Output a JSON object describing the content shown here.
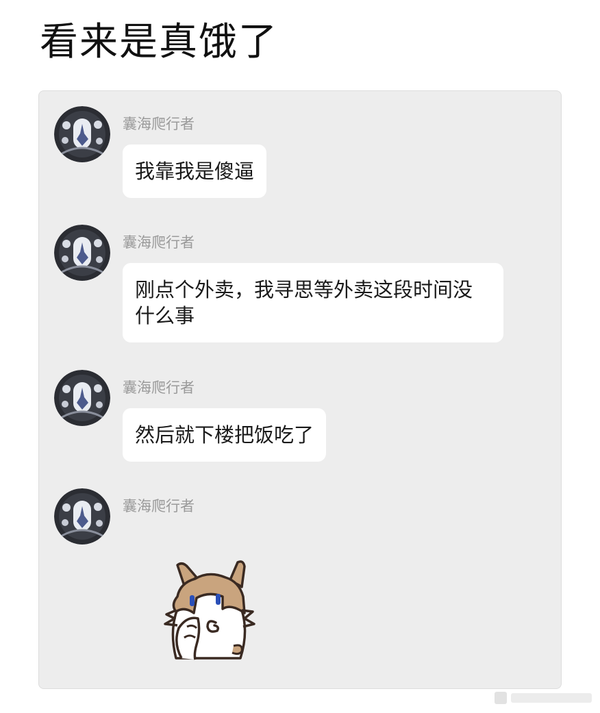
{
  "post": {
    "title": "看来是真饿了"
  },
  "chat": {
    "messages": [
      {
        "sender": "囊海爬行者",
        "text": "我靠我是傻逼",
        "type": "text"
      },
      {
        "sender": "囊海爬行者",
        "text": "刚点个外卖，我寻思等外卖这段时间没什么事",
        "type": "text"
      },
      {
        "sender": "囊海爬行者",
        "text": "然后就下楼把饭吃了",
        "type": "text"
      },
      {
        "sender": "囊海爬行者",
        "text": "",
        "type": "sticker",
        "sticker_icon": "cat-covering-face-sticker"
      }
    ]
  },
  "colors": {
    "card_background": "#ededed",
    "bubble_background": "#ffffff",
    "sender_text": "#9a9a9a",
    "cat_fur": "#c9a47e"
  }
}
